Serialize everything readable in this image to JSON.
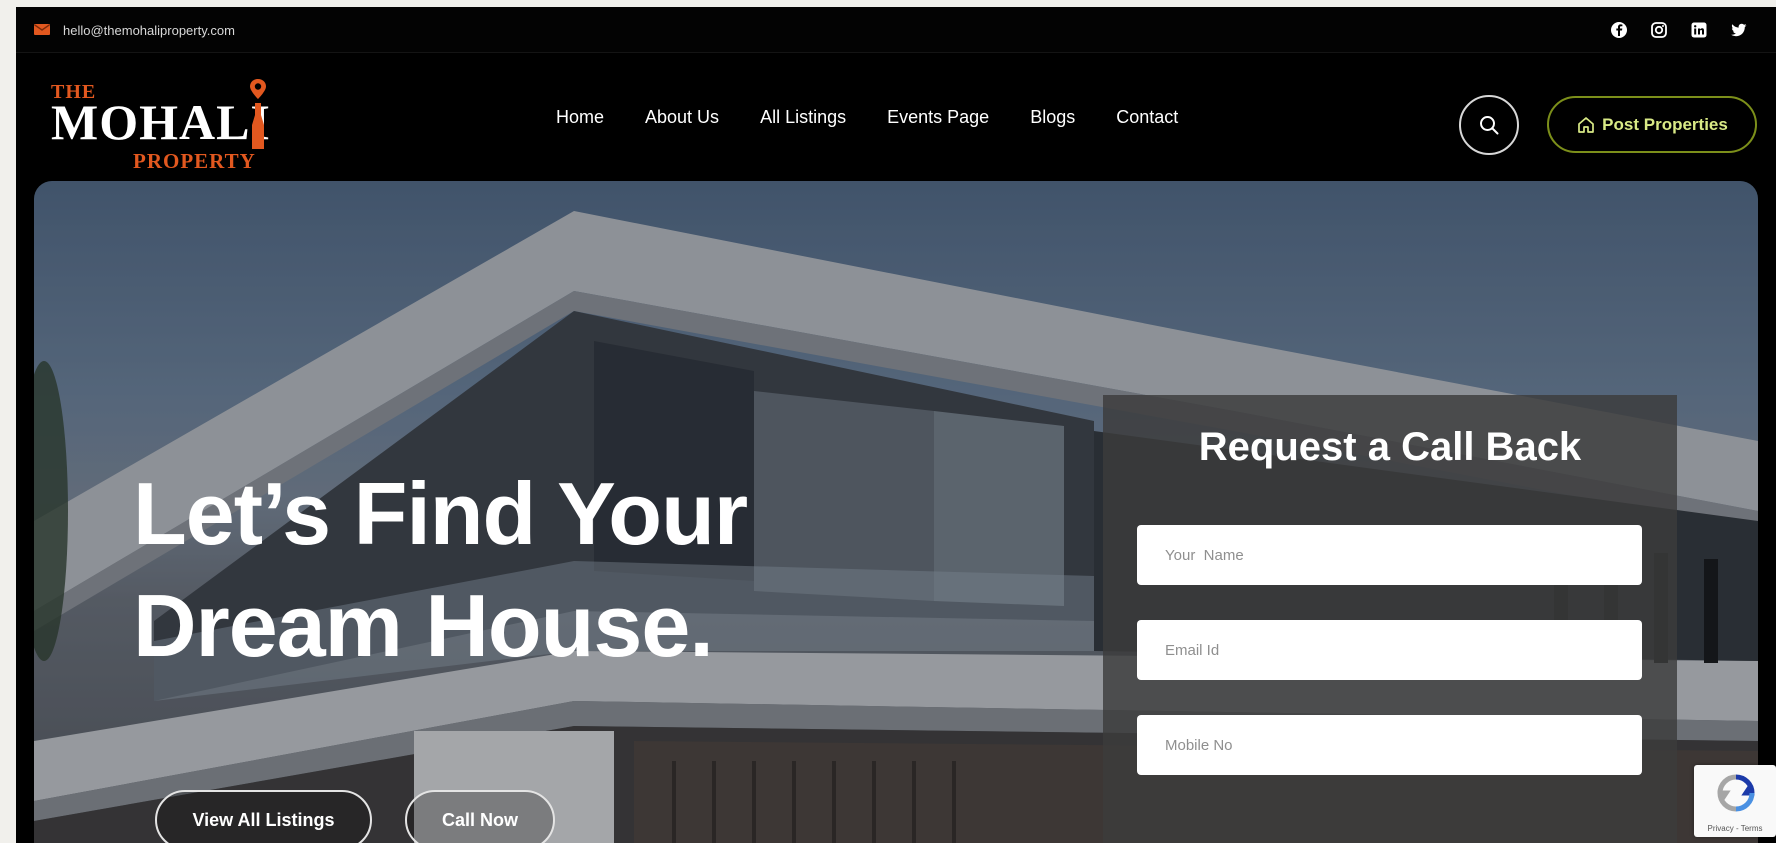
{
  "topbar": {
    "email": "hello@themohaliproperty.com",
    "social_icons": [
      "facebook-icon",
      "instagram-icon",
      "linkedin-icon",
      "twitter-icon"
    ]
  },
  "brand": {
    "the": "THE",
    "name": "MOHALI",
    "sub": "PROPERTY",
    "accent_color": "#e2581f"
  },
  "nav": {
    "items": [
      {
        "label": "Home"
      },
      {
        "label": "About Us"
      },
      {
        "label": "All Listings"
      },
      {
        "label": "Events Page"
      },
      {
        "label": "Blogs"
      },
      {
        "label": "Contact"
      }
    ],
    "post_label": "Post Properties"
  },
  "hero": {
    "line1": "Let’s Find Your",
    "line2": "Dream House.",
    "btn_listings": "View All Listings",
    "btn_call": "Call Now"
  },
  "form": {
    "title": "Request a Call Back",
    "name_placeholder": "Your  Name",
    "email_placeholder": "Email Id",
    "mobile_placeholder": "Mobile No"
  },
  "recaptcha": {
    "terms": "Privacy - Terms"
  }
}
